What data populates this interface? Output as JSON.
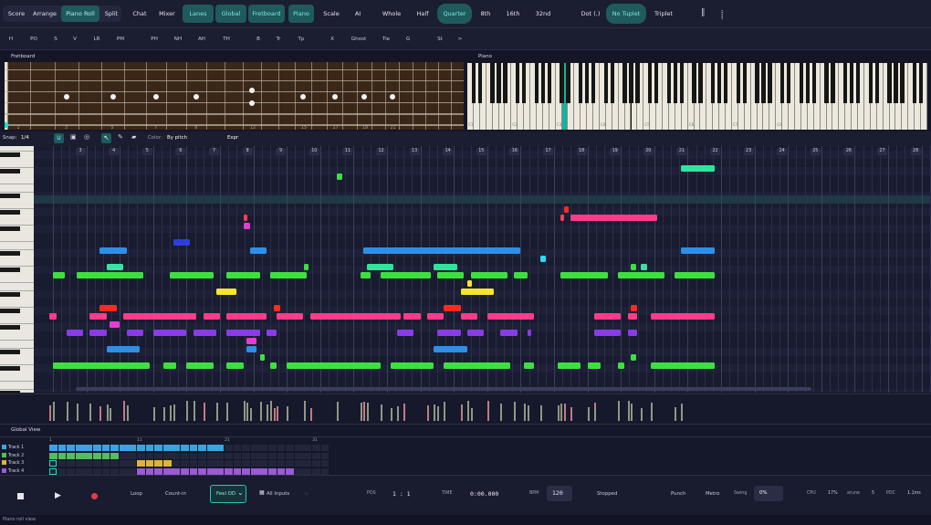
{
  "view_tabs": [
    {
      "label": "Score"
    },
    {
      "label": "Arrange"
    },
    {
      "label": "Piano Roll",
      "active": true
    },
    {
      "label": "Split"
    }
  ],
  "panels": [
    {
      "label": "Chat"
    },
    {
      "label": "Mixer"
    },
    {
      "label": "Lanes",
      "active": true
    },
    {
      "label": "Global",
      "active": true
    },
    {
      "label": "Fretboard",
      "active": true
    },
    {
      "label": "Piano",
      "active": true
    },
    {
      "label": "Scale"
    },
    {
      "label": "AI"
    }
  ],
  "durations": [
    {
      "label": "Whole"
    },
    {
      "label": "Half"
    },
    {
      "label": "Quarter",
      "active": true
    },
    {
      "label": "8th"
    },
    {
      "label": "16th"
    },
    {
      "label": "32nd"
    }
  ],
  "modifiers": [
    {
      "label": "Dot (.)"
    },
    {
      "label": "No Tuplet",
      "active": true
    },
    {
      "label": "Triplet"
    }
  ],
  "articulations": [
    "H",
    "PO",
    "S",
    "V",
    "LR",
    "PM",
    "PH",
    "NH",
    "AH",
    "TH",
    "B",
    "Tr",
    "Tp",
    "X",
    "Ghost",
    "Tie",
    "G",
    "St",
    ">"
  ],
  "fretboard": {
    "title": "Fretboard",
    "fret_numbers": [
      "1",
      "3",
      "5",
      "7",
      "9",
      "12",
      "15",
      "17",
      "19",
      "21"
    ]
  },
  "piano": {
    "title": "Piano",
    "octave_labels": [
      "C1",
      "C2",
      "C3",
      "C4",
      "C5",
      "C6",
      "C7",
      "C8"
    ]
  },
  "editor": {
    "snap_label": "Snap:",
    "snap_value": "1/4",
    "color_label": "Color:",
    "color_value": "By pitch",
    "expr_label": "Expr"
  },
  "bar_numbers": [
    "3",
    "4",
    "5",
    "6",
    "7",
    "8",
    "9",
    "10",
    "11",
    "12",
    "13",
    "14",
    "15",
    "16",
    "17",
    "18",
    "19",
    "20",
    "21",
    "22",
    "23",
    "24",
    "25",
    "26",
    "27",
    "28"
  ],
  "notes": [
    {
      "bar": 19.8,
      "len": 1,
      "row": 3,
      "color": "#2ee59b"
    },
    {
      "bar": 9.5,
      "len": 0.15,
      "row": 4,
      "color": "#3ee040"
    },
    {
      "bar": 16.3,
      "len": 0.15,
      "row": 8,
      "color": "#ff2a1f"
    },
    {
      "bar": 16.2,
      "len": 0.1,
      "row": 9,
      "color": "#ff3b5c"
    },
    {
      "bar": 16.5,
      "len": 2.6,
      "row": 9,
      "color": "#ff3b8a"
    },
    {
      "bar": 6.7,
      "len": 0.1,
      "row": 9,
      "color": "#ff3b5c"
    },
    {
      "bar": 6.7,
      "len": 0.2,
      "row": 10,
      "color": "#e83bd6"
    },
    {
      "bar": 4.6,
      "len": 0.5,
      "row": 12,
      "color": "#2b3fe0"
    },
    {
      "bar": 2.4,
      "len": 0.8,
      "row": 13,
      "color": "#2e8fe8"
    },
    {
      "bar": 6.9,
      "len": 0.5,
      "row": 13,
      "color": "#2e8fe8"
    },
    {
      "bar": 10.3,
      "len": 4.7,
      "row": 13,
      "color": "#2e8fe8"
    },
    {
      "bar": 19.8,
      "len": 1,
      "row": 13,
      "color": "#2e8fe8"
    },
    {
      "bar": 15.6,
      "len": 0.15,
      "row": 14,
      "color": "#2ed7ff"
    },
    {
      "bar": 2.6,
      "len": 0.5,
      "row": 15,
      "color": "#3ee0a0"
    },
    {
      "bar": 8.5,
      "len": 0.15,
      "row": 15,
      "color": "#3ee040"
    },
    {
      "bar": 10.4,
      "len": 0.8,
      "row": 15,
      "color": "#2ee59b"
    },
    {
      "bar": 12.4,
      "len": 0.7,
      "row": 15,
      "color": "#2ee59b"
    },
    {
      "bar": 18.3,
      "len": 0.15,
      "row": 15,
      "color": "#3ee040"
    },
    {
      "bar": 18.6,
      "len": 0.2,
      "row": 15,
      "color": "#3ee0a0"
    },
    {
      "bar": 1,
      "len": 0.35,
      "row": 16,
      "color": "#3ee040"
    },
    {
      "bar": 1.7,
      "len": 2.0,
      "row": 16,
      "color": "#3ee040"
    },
    {
      "bar": 4.5,
      "len": 1.3,
      "row": 16,
      "color": "#3ee040"
    },
    {
      "bar": 6.2,
      "len": 1.0,
      "row": 16,
      "color": "#3ee040"
    },
    {
      "bar": 7.5,
      "len": 1.1,
      "row": 16,
      "color": "#3ee040"
    },
    {
      "bar": 10.2,
      "len": 0.3,
      "row": 16,
      "color": "#3ee040"
    },
    {
      "bar": 10.8,
      "len": 1.5,
      "row": 16,
      "color": "#3ee040"
    },
    {
      "bar": 12.5,
      "len": 0.8,
      "row": 16,
      "color": "#3ee040"
    },
    {
      "bar": 13.5,
      "len": 1.1,
      "row": 16,
      "color": "#3ee040"
    },
    {
      "bar": 14.8,
      "len": 0.4,
      "row": 16,
      "color": "#3ee040"
    },
    {
      "bar": 16.2,
      "len": 1.4,
      "row": 16,
      "color": "#3ee040"
    },
    {
      "bar": 17.9,
      "len": 1.4,
      "row": 16,
      "color": "#3ee040"
    },
    {
      "bar": 19.6,
      "len": 1.2,
      "row": 16,
      "color": "#3ee040"
    },
    {
      "bar": 13.4,
      "len": 0.15,
      "row": 17,
      "color": "#f5e52e"
    },
    {
      "bar": 5.9,
      "len": 0.6,
      "row": 18,
      "color": "#f5e52e"
    },
    {
      "bar": 13.2,
      "len": 1.0,
      "row": 18,
      "color": "#f5e52e"
    },
    {
      "bar": 2.4,
      "len": 0.5,
      "row": 20,
      "color": "#ff2a1f"
    },
    {
      "bar": 7.6,
      "len": 0.2,
      "row": 20,
      "color": "#ff2a1f"
    },
    {
      "bar": 12.7,
      "len": 0.5,
      "row": 20,
      "color": "#ff2a1f"
    },
    {
      "bar": 18.3,
      "len": 0.2,
      "row": 20,
      "color": "#ff2a1f"
    },
    {
      "bar": 0.9,
      "len": 0.2,
      "row": 21,
      "color": "#ff3b8a"
    },
    {
      "bar": 2.1,
      "len": 0.5,
      "row": 21,
      "color": "#ff3b8a"
    },
    {
      "bar": 3.1,
      "len": 2.2,
      "row": 21,
      "color": "#ff3b8a"
    },
    {
      "bar": 5.5,
      "len": 0.5,
      "row": 21,
      "color": "#ff3b8a"
    },
    {
      "bar": 6.2,
      "len": 1.2,
      "row": 21,
      "color": "#ff3b8a"
    },
    {
      "bar": 7.7,
      "len": 0.8,
      "row": 21,
      "color": "#ff3b8a"
    },
    {
      "bar": 8.7,
      "len": 2.3,
      "row": 21,
      "color": "#ff3b8a"
    },
    {
      "bar": 10.3,
      "len": 1.1,
      "row": 21,
      "color": "#ff3b8a"
    },
    {
      "bar": 11.5,
      "len": 0.5,
      "row": 21,
      "color": "#ff3b8a"
    },
    {
      "bar": 12.2,
      "len": 0.5,
      "row": 21,
      "color": "#ff3b8a"
    },
    {
      "bar": 13.2,
      "len": 0.5,
      "row": 21,
      "color": "#ff3b8a"
    },
    {
      "bar": 14.0,
      "len": 1.4,
      "row": 21,
      "color": "#ff3b8a"
    },
    {
      "bar": 17.2,
      "len": 0.8,
      "row": 21,
      "color": "#ff3b8a"
    },
    {
      "bar": 18.2,
      "len": 0.3,
      "row": 21,
      "color": "#ff3b8a"
    },
    {
      "bar": 18.9,
      "len": 1.9,
      "row": 21,
      "color": "#ff3b8a"
    },
    {
      "bar": 2.7,
      "len": 0.3,
      "row": 22,
      "color": "#e83bd6"
    },
    {
      "bar": 1.4,
      "len": 0.5,
      "row": 23,
      "color": "#8a3be8"
    },
    {
      "bar": 2.1,
      "len": 0.5,
      "row": 23,
      "color": "#8a3be8"
    },
    {
      "bar": 3.2,
      "len": 0.5,
      "row": 23,
      "color": "#8a3be8"
    },
    {
      "bar": 4.0,
      "len": 1.0,
      "row": 23,
      "color": "#8a3be8"
    },
    {
      "bar": 5.2,
      "len": 0.7,
      "row": 23,
      "color": "#8a3be8"
    },
    {
      "bar": 6.2,
      "len": 1.0,
      "row": 23,
      "color": "#8a3be8"
    },
    {
      "bar": 7.4,
      "len": 0.3,
      "row": 23,
      "color": "#8a3be8"
    },
    {
      "bar": 11.3,
      "len": 0.5,
      "row": 23,
      "color": "#8a3be8"
    },
    {
      "bar": 12.5,
      "len": 0.7,
      "row": 23,
      "color": "#8a3be8"
    },
    {
      "bar": 13.4,
      "len": 0.5,
      "row": 23,
      "color": "#8a3be8"
    },
    {
      "bar": 14.4,
      "len": 0.5,
      "row": 23,
      "color": "#8a3be8"
    },
    {
      "bar": 15.2,
      "len": 0.1,
      "row": 23,
      "color": "#8a3be8"
    },
    {
      "bar": 17.2,
      "len": 0.8,
      "row": 23,
      "color": "#8a3be8"
    },
    {
      "bar": 18.2,
      "len": 0.3,
      "row": 23,
      "color": "#8a3be8"
    },
    {
      "bar": 6.8,
      "len": 0.3,
      "row": 24,
      "color": "#e83bd6"
    },
    {
      "bar": 2.6,
      "len": 1.0,
      "row": 25,
      "color": "#2e8fe8"
    },
    {
      "bar": 6.8,
      "len": 0.3,
      "row": 25,
      "color": "#2e8fe8"
    },
    {
      "bar": 12.4,
      "len": 1.0,
      "row": 25,
      "color": "#2e8fe8"
    },
    {
      "bar": 7.2,
      "len": 0.15,
      "row": 26,
      "color": "#3ee040"
    },
    {
      "bar": 18.3,
      "len": 0.15,
      "row": 26,
      "color": "#3ee040"
    },
    {
      "bar": 1,
      "len": 2.9,
      "row": 27,
      "color": "#3ee040"
    },
    {
      "bar": 4.3,
      "len": 0.4,
      "row": 27,
      "color": "#3ee040"
    },
    {
      "bar": 5.0,
      "len": 0.8,
      "row": 27,
      "color": "#3ee040"
    },
    {
      "bar": 6.2,
      "len": 0.5,
      "row": 27,
      "color": "#3ee040"
    },
    {
      "bar": 7.5,
      "len": 0.2,
      "row": 27,
      "color": "#3ee040"
    },
    {
      "bar": 8.0,
      "len": 2.8,
      "row": 27,
      "color": "#3ee040"
    },
    {
      "bar": 11.1,
      "len": 1.3,
      "row": 27,
      "color": "#3ee040"
    },
    {
      "bar": 12.7,
      "len": 2.0,
      "row": 27,
      "color": "#3ee040"
    },
    {
      "bar": 15.1,
      "len": 0.3,
      "row": 27,
      "color": "#3ee040"
    },
    {
      "bar": 16.1,
      "len": 0.7,
      "row": 27,
      "color": "#3ee040"
    },
    {
      "bar": 17.0,
      "len": 0.4,
      "row": 27,
      "color": "#3ee040"
    },
    {
      "bar": 17.9,
      "len": 0.2,
      "row": 27,
      "color": "#3ee040"
    },
    {
      "bar": 18.9,
      "len": 1.9,
      "row": 27,
      "color": "#3ee040"
    }
  ],
  "global_view": {
    "title": "Global View",
    "bar_labels": [
      "1",
      "11",
      "21",
      "31"
    ],
    "tracks": [
      {
        "name": "Track 1",
        "color": "#3fa2e0"
      },
      {
        "name": "Track 2",
        "color": "#4fc05a"
      },
      {
        "name": "Track 3",
        "color": "#e0b33f"
      },
      {
        "name": "Track 4",
        "color": "#9b5ad6"
      }
    ]
  },
  "transport": {
    "loop": "Loop",
    "count_in": "Count-in",
    "feel": "Feel OD",
    "inputs": "All Inputs",
    "pos_label": "POS",
    "pos_value": "1 : 1",
    "time_label": "TIME",
    "time_value": "0:00.000",
    "bpm_label": "BPM",
    "bpm_value": "120",
    "state": "Stopped",
    "punch": "Punch",
    "metro": "Metro",
    "swing_label": "Swing",
    "swing_value": "0%",
    "cpu_label": "CPU",
    "cpu_value": "17%",
    "sr_label": "arune",
    "sr_value": "5",
    "pdc_label": "PDC",
    "pdc_value": "1.1ms"
  },
  "status_text": "Piano roll view"
}
